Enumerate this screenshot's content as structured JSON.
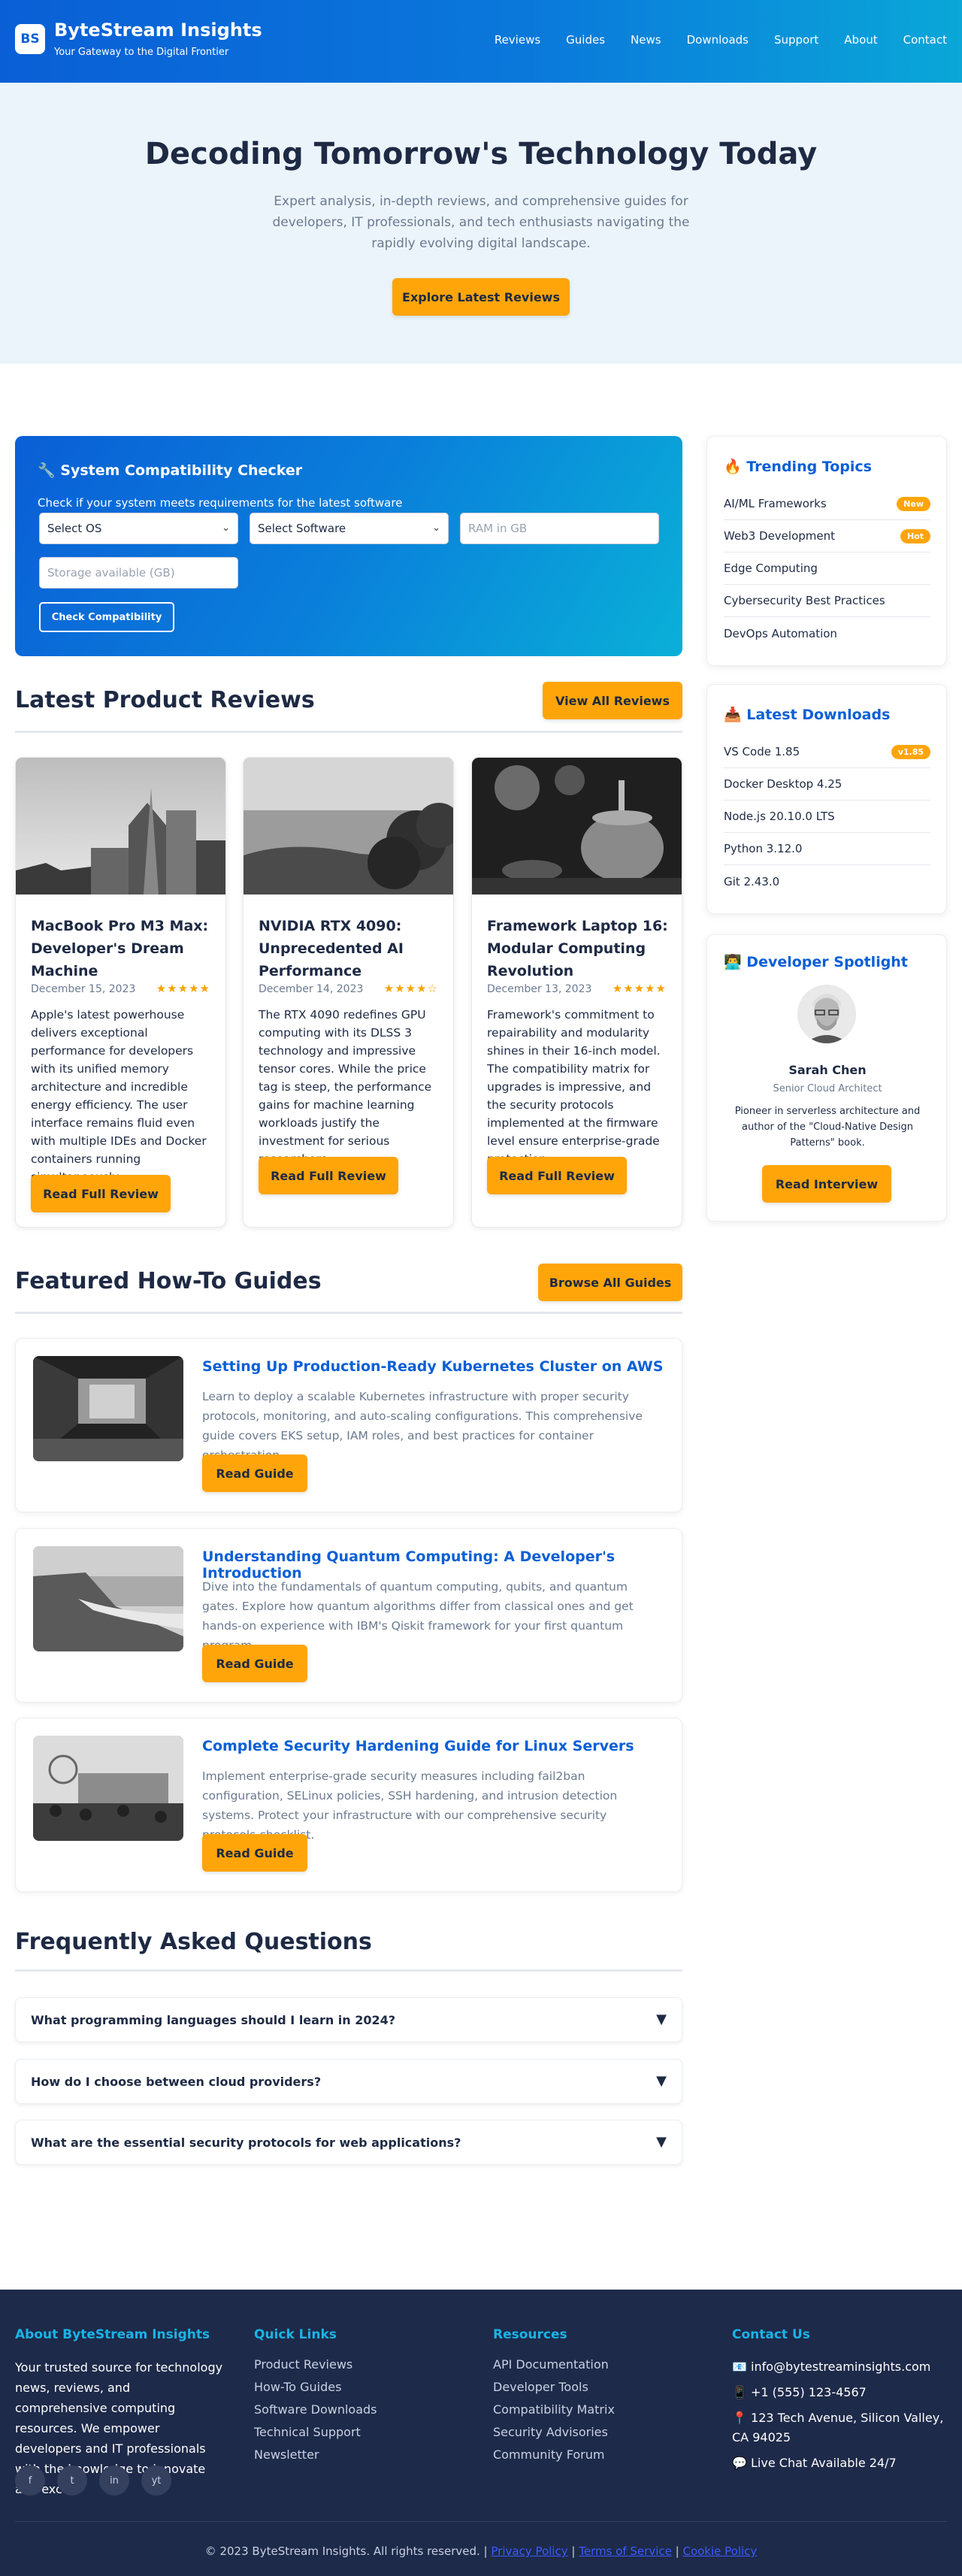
{
  "header": {
    "logo": "BS",
    "brand": "ByteStream Insights",
    "tagline": "Your Gateway to the Digital Frontier",
    "nav": [
      "Reviews",
      "Guides",
      "News",
      "Downloads",
      "Support",
      "About",
      "Contact"
    ]
  },
  "hero": {
    "title": "Decoding Tomorrow's Technology Today",
    "subtitle": "Expert analysis, in-depth reviews, and comprehensive guides for developers, IT professionals, and tech enthusiasts navigating the rapidly evolving digital landscape.",
    "cta": "Explore Latest Reviews"
  },
  "compat": {
    "icon": "🔧",
    "title": "System Compatibility Checker",
    "subtitle": "Check if your system meets requirements for the latest software",
    "os_select": "Select OS",
    "software_select": "Select Software",
    "ram_placeholder": "RAM in GB",
    "storage_placeholder": "Storage available (GB)",
    "button": "Check Compatibility"
  },
  "reviews": {
    "heading": "Latest Product Reviews",
    "view_all": "View All Reviews",
    "items": [
      {
        "title": "MacBook Pro M3 Max: Developer's Dream Machine",
        "date": "December 15, 2023",
        "stars": "★★★★★",
        "rating": 5,
        "desc": "Apple's latest powerhouse delivers exceptional performance for developers with its unified memory architecture and incredible energy efficiency. The user interface remains fluid even with multiple IDEs and Docker containers running simultaneously.",
        "button": "Read Full Review"
      },
      {
        "title": "NVIDIA RTX 4090: Unprecedented AI Performance",
        "date": "December 14, 2023",
        "stars": "★★★★☆",
        "rating": 4,
        "desc": "The RTX 4090 redefines GPU computing with its DLSS 3 technology and impressive tensor cores. While the price tag is steep, the performance gains for machine learning workloads justify the investment for serious researchers.",
        "button": "Read Full Review"
      },
      {
        "title": "Framework Laptop 16: Modular Computing Revolution",
        "date": "December 13, 2023",
        "stars": "★★★★★",
        "rating": 5,
        "desc": "Framework's commitment to repairability and modularity shines in their 16-inch model. The compatibility matrix for upgrades is impressive, and the security protocols implemented at the firmware level ensure enterprise-grade protection.",
        "button": "Read Full Review"
      }
    ]
  },
  "guides": {
    "heading": "Featured How-To Guides",
    "browse": "Browse All Guides",
    "items": [
      {
        "title": "Setting Up Production-Ready Kubernetes Cluster on AWS",
        "desc": "Learn to deploy a scalable Kubernetes infrastructure with proper security protocols, monitoring, and auto-scaling configurations. This comprehensive guide covers EKS setup, IAM roles, and best practices for container orchestration.",
        "button": "Read Guide"
      },
      {
        "title": "Understanding Quantum Computing: A Developer's Introduction",
        "desc": "Dive into the fundamentals of quantum computing, qubits, and quantum gates. Explore how quantum algorithms differ from classical ones and get hands-on experience with IBM's Qiskit framework for your first quantum program.",
        "button": "Read Guide"
      },
      {
        "title": "Complete Security Hardening Guide for Linux Servers",
        "desc": "Implement enterprise-grade security measures including fail2ban configuration, SELinux policies, SSH hardening, and intrusion detection systems. Protect your infrastructure with our comprehensive security protocols checklist.",
        "button": "Read Guide"
      }
    ]
  },
  "faq": {
    "heading": "Frequently Asked Questions",
    "items": [
      "What programming languages should I learn in 2024?",
      "How do I choose between cloud providers?",
      "What are the essential security protocols for web applications?"
    ],
    "toggle": "▼"
  },
  "trending": {
    "icon": "🔥",
    "title": "Trending Topics",
    "items": [
      {
        "label": "AI/ML Frameworks",
        "badge": "New"
      },
      {
        "label": "Web3 Development",
        "badge": "Hot"
      },
      {
        "label": "Edge Computing",
        "badge": ""
      },
      {
        "label": "Cybersecurity Best Practices",
        "badge": ""
      },
      {
        "label": "DevOps Automation",
        "badge": ""
      }
    ]
  },
  "downloads": {
    "icon": "📥",
    "title": "Latest Downloads",
    "items": [
      {
        "label": "VS Code 1.85",
        "badge": "v1.85"
      },
      {
        "label": "Docker Desktop 4.25",
        "badge": ""
      },
      {
        "label": "Node.js 20.10.0 LTS",
        "badge": ""
      },
      {
        "label": "Python 3.12.0",
        "badge": ""
      },
      {
        "label": "Git 2.43.0",
        "badge": ""
      }
    ]
  },
  "spotlight": {
    "icon": "👨‍💻",
    "title": "Developer Spotlight",
    "name": "Sarah Chen",
    "role": "Senior Cloud Architect",
    "bio": "Pioneer in serverless architecture and author of the \"Cloud-Native Design Patterns\" book.",
    "button": "Read Interview"
  },
  "footer": {
    "about_title": "About ByteStream Insights",
    "about_text": "Your trusted source for technology news, reviews, and comprehensive computing resources. We empower developers and IT professionals with the knowledge to innovate and excel.",
    "social": [
      "f",
      "t",
      "in",
      "yt"
    ],
    "quick_title": "Quick Links",
    "quick": [
      "Product Reviews",
      "How-To Guides",
      "Software Downloads",
      "Technical Support",
      "Newsletter"
    ],
    "res_title": "Resources",
    "resources": [
      "API Documentation",
      "Developer Tools",
      "Compatibility Matrix",
      "Security Advisories",
      "Community Forum"
    ],
    "contact_title": "Contact Us",
    "contact": [
      "📧 info@bytestreaminsights.com",
      "📱 +1 (555) 123-4567",
      "📍 123 Tech Avenue, Silicon Valley, CA 94025",
      "💬 Live Chat Available 24/7"
    ],
    "copyright": "© 2023 ByteStream Insights. All rights reserved. |",
    "links": [
      "Privacy Policy",
      "Terms of Service",
      "Cookie Policy"
    ],
    "sep": "|"
  },
  "colors": {
    "primary": "#0a5fd6",
    "accent": "#ffa50a",
    "footer": "#1e2a4a",
    "footer_heading": "#19b4e6"
  }
}
